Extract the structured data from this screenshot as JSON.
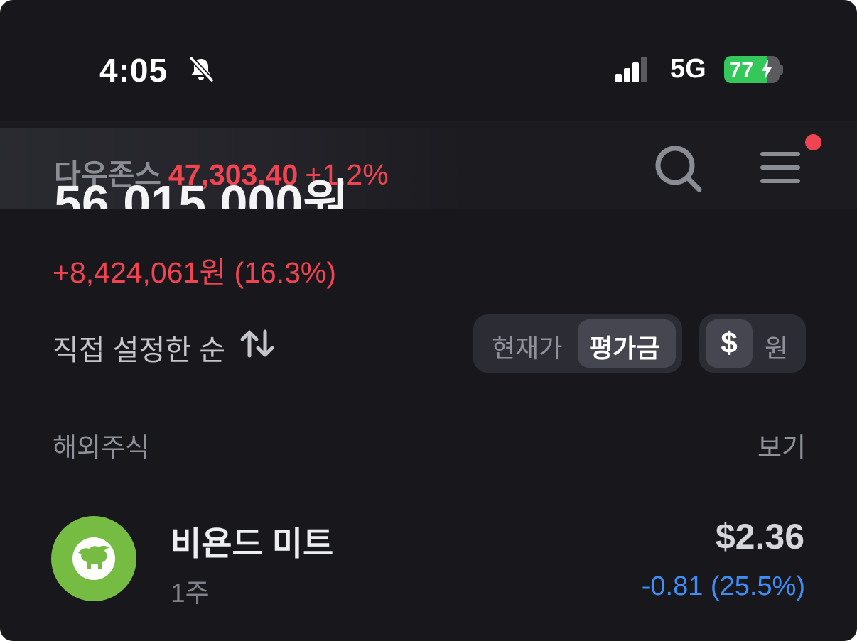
{
  "status_bar": {
    "time": "4:05",
    "network": "5G",
    "battery": "77",
    "battery_level_pct": 77,
    "silent_icon": "bell-slash-icon",
    "signal_icon": "cellular-signal-icon",
    "charging_icon": "bolt-icon"
  },
  "header": {
    "ticker_name": "다우존스",
    "ticker_value": "47,303.40",
    "ticker_change": "+1.2%",
    "search_icon": "search-icon",
    "menu_icon": "hamburger-menu-icon"
  },
  "summary": {
    "balance_partial": "56,015,000원",
    "profit": "+8,424,061원 (16.3%)"
  },
  "controls": {
    "sort_label": "직접 설정한 순",
    "sort_icon": "sort-arrows-icon",
    "price_toggle": [
      "현재가",
      "평가금"
    ],
    "price_toggle_selected": "평가금",
    "currency_toggle": [
      "$",
      "원"
    ],
    "currency_toggle_selected": "$"
  },
  "section": {
    "title": "해외주식",
    "link": "보기"
  },
  "holdings": [
    {
      "name": "비욘드 미트",
      "quantity": "1주",
      "price": "$2.36",
      "change": "-0.81 (25.5%)",
      "logo_icon": "beyond-meat-logo-icon"
    }
  ],
  "colors": {
    "background": "#17171c",
    "up_red": "#f04452",
    "down_blue": "#3d8ef7",
    "logo_green": "#76bc43",
    "battery_green": "#34c759"
  }
}
